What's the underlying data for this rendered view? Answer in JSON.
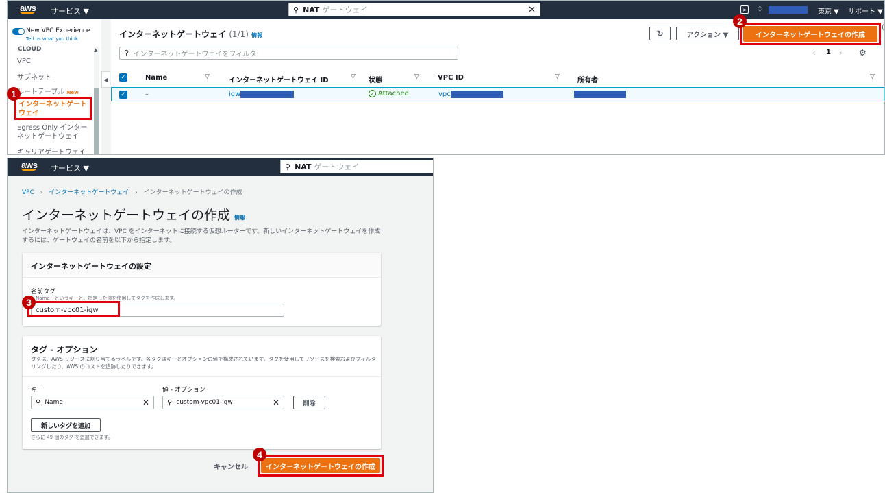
{
  "top": {
    "nav": {
      "logo": "aws",
      "services": "サービス ▼",
      "search_value": "NAT",
      "search_suffix": "ゲートウェイ",
      "region": "東京 ▼",
      "support": "サポート ▼"
    },
    "sidebar": {
      "toggle_label": "New VPC Experience",
      "toggle_sub": "Tell us what you think",
      "section": "CLOUD",
      "items": [
        {
          "label": "VPC"
        },
        {
          "label": "サブネット"
        },
        {
          "label": "ルートテーブル",
          "badge": "New"
        },
        {
          "label": "インターネットゲートウェイ"
        },
        {
          "label": "Egress Only インターネットゲートウェイ"
        },
        {
          "label": "キャリアゲートウェイ"
        }
      ]
    },
    "main": {
      "title": "インターネットゲートウェイ",
      "count": "(1/1)",
      "info": "情報",
      "actions": "アクション ▼",
      "create_button": "インターネットゲートウェイの作成",
      "filter_placeholder": "インターネットゲートウェイをフィルタ",
      "page": "1",
      "columns": [
        "Name",
        "インターネットゲートウェイ ID",
        "状態",
        "VPC ID",
        "所有者"
      ],
      "row": {
        "name": "–",
        "igw_prefix": "igw",
        "state": "Attached",
        "vpc_prefix": "vpc"
      }
    }
  },
  "bottom": {
    "nav": {
      "logo": "aws",
      "services": "サービス ▼",
      "search_value": "NAT",
      "search_suffix": "ゲートウェイ"
    },
    "breadcrumb": [
      "VPC",
      "インターネットゲートウェイ",
      "インターネットゲートウェイの作成"
    ],
    "title": "インターネットゲートウェイの作成",
    "info": "情報",
    "description": "インターネットゲートウェイは、VPC をインターネットに接続する仮想ルーターです。新しいインターネットゲートウェイを作成するには、ゲートウェイの名前を以下から指定します。",
    "settings": {
      "header": "インターネットゲートウェイの設定",
      "name_label": "名前タグ",
      "name_help": "「Name」というキーと、指定した値を使用してタグを作成します。",
      "name_value": "custom-vpc01-igw"
    },
    "tags": {
      "header": "タグ - オプション",
      "description": "タグは、AWS リソースに割り当てるラベルです。各タグはキーとオプションの値で構成されています。タグを使用してリソースを検索およびフィルタリングしたり、AWS のコストを追跡したりできます。",
      "key_label": "キー",
      "value_label": "値 - オプション",
      "key_value": "Name",
      "value_value": "custom-vpc01-igw",
      "remove_button": "削除",
      "add_button": "新しいタグを追加",
      "limit_note": "さらに 49 個のタグ を追加できます。"
    },
    "cancel": "キャンセル",
    "create_button": "インターネットゲートウェイの作成"
  },
  "badges": [
    "1",
    "2",
    "3",
    "4"
  ],
  "colors": {
    "nav_bg": "#232f3e",
    "primary": "#ec7211",
    "link": "#0073bb",
    "highlight": "#e0000b",
    "success": "#1d8102"
  }
}
